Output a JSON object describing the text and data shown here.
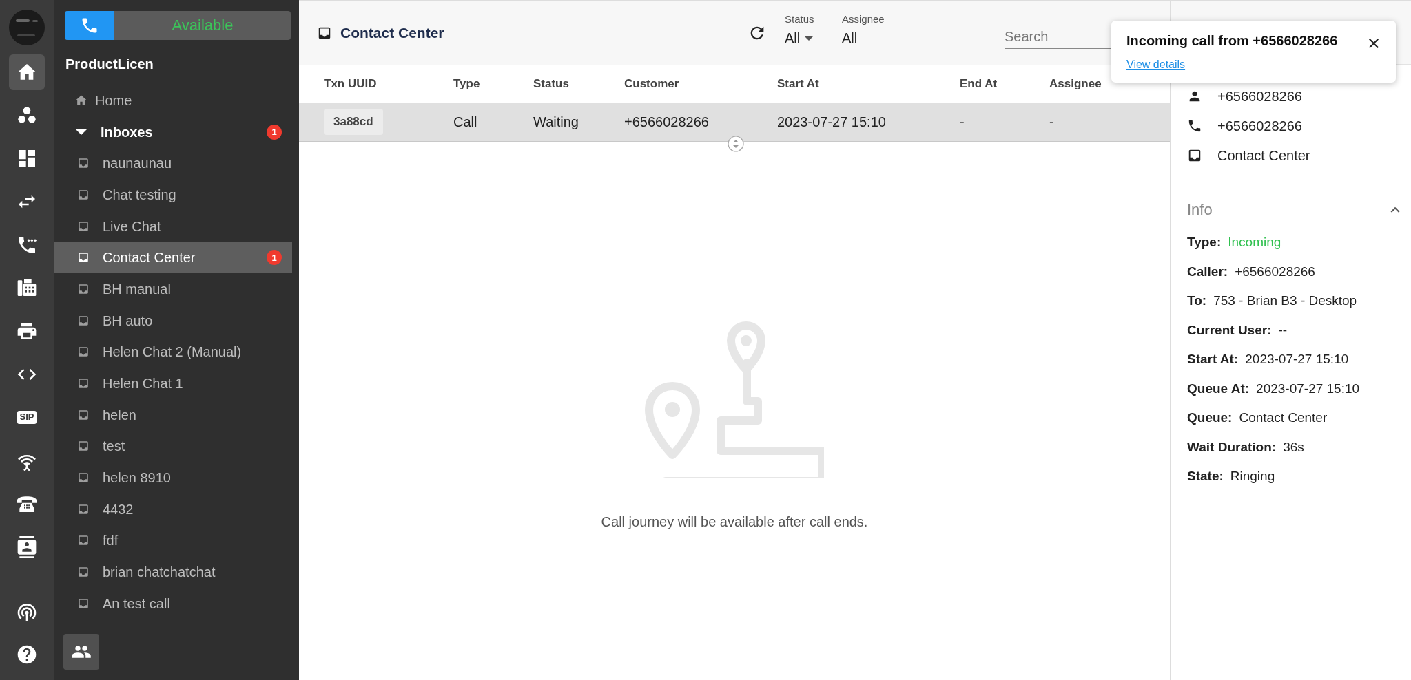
{
  "rail": {
    "items": [
      {
        "kind": "home",
        "selected": true
      },
      {
        "kind": "dots",
        "selected": false
      },
      {
        "kind": "dashboard",
        "selected": false
      },
      {
        "kind": "arrows",
        "selected": false
      },
      {
        "kind": "phone-dots",
        "selected": false
      },
      {
        "kind": "fax",
        "selected": false
      },
      {
        "kind": "printer",
        "selected": false
      },
      {
        "kind": "code",
        "selected": false
      },
      {
        "kind": "sip",
        "label": "SIP",
        "selected": false
      },
      {
        "kind": "antenna",
        "selected": false
      },
      {
        "kind": "telephone",
        "selected": false
      },
      {
        "kind": "contact-card",
        "selected": false
      }
    ],
    "bottom_items": [
      {
        "kind": "broadcast",
        "selected": false
      },
      {
        "kind": "help",
        "selected": false
      }
    ]
  },
  "sidebar": {
    "status_button": {
      "label": "Available"
    },
    "title": "ProductLicen",
    "items": [
      {
        "kind": "home",
        "label": "Home"
      },
      {
        "kind": "group",
        "label": "Inboxes",
        "expanded": true,
        "badge": "1",
        "children": [
          {
            "label": "naunaunau",
            "selected": false
          },
          {
            "label": "Chat testing",
            "selected": false
          },
          {
            "label": "Live Chat",
            "selected": false
          },
          {
            "label": "Contact Center",
            "selected": true,
            "badge": "1"
          },
          {
            "label": "BH manual",
            "selected": false
          },
          {
            "label": "BH auto",
            "selected": false
          },
          {
            "label": "Helen Chat 2 (Manual)",
            "selected": false
          },
          {
            "label": "Helen Chat 1",
            "selected": false
          },
          {
            "label": "helen",
            "selected": false
          },
          {
            "label": "test",
            "selected": false
          },
          {
            "label": "helen 8910",
            "selected": false
          },
          {
            "label": "4432",
            "selected": false
          },
          {
            "label": "fdf",
            "selected": false
          },
          {
            "label": "brian chatchatchat",
            "selected": false
          },
          {
            "label": "An test call",
            "selected": false
          }
        ]
      }
    ]
  },
  "header": {
    "title": "Contact Center",
    "filters": [
      {
        "kind": "select",
        "label": "Status",
        "value": "All"
      },
      {
        "kind": "text",
        "label": "Assignee",
        "value": "All"
      }
    ],
    "search": {
      "placeholder": "Search"
    }
  },
  "table": {
    "columns": [
      "Txn UUID",
      "Type",
      "Status",
      "Customer",
      "Start At",
      "End At",
      "Assignee"
    ],
    "rows": [
      {
        "selected": true,
        "cells": [
          "3a88cd",
          "Call",
          "Waiting",
          "+6566028266",
          "2023-07-27 15:10",
          "-",
          "-"
        ]
      }
    ]
  },
  "empty_state": {
    "message": "Call journey will be available after call ends."
  },
  "details": {
    "contact": [
      {
        "kind": "person",
        "text": "+6566028266"
      },
      {
        "kind": "phone",
        "text": "+6566028266"
      },
      {
        "kind": "inbox",
        "text": "Contact Center"
      }
    ],
    "info": {
      "title": "Info",
      "expanded": true,
      "fields": [
        {
          "label": "Type:",
          "value": "Incoming",
          "accent": true
        },
        {
          "label": "Caller:",
          "value": "+6566028266",
          "accent": false
        },
        {
          "label": "To:",
          "value": "753 - Brian B3  - Desktop",
          "accent": false
        },
        {
          "label": "Current User:",
          "value": "--",
          "accent": false
        },
        {
          "label": "Start At:",
          "value": "2023-07-27 15:10",
          "accent": false
        },
        {
          "label": "Queue At:",
          "value": "2023-07-27 15:10",
          "accent": false
        },
        {
          "label": "Queue:",
          "value": "Contact Center",
          "accent": false
        },
        {
          "label": "Wait Duration:",
          "value": "36s",
          "accent": false
        },
        {
          "label": "State:",
          "value": "Ringing",
          "accent": false
        }
      ]
    }
  },
  "toast": {
    "title": "Incoming call from +6566028266",
    "link": "View details"
  }
}
